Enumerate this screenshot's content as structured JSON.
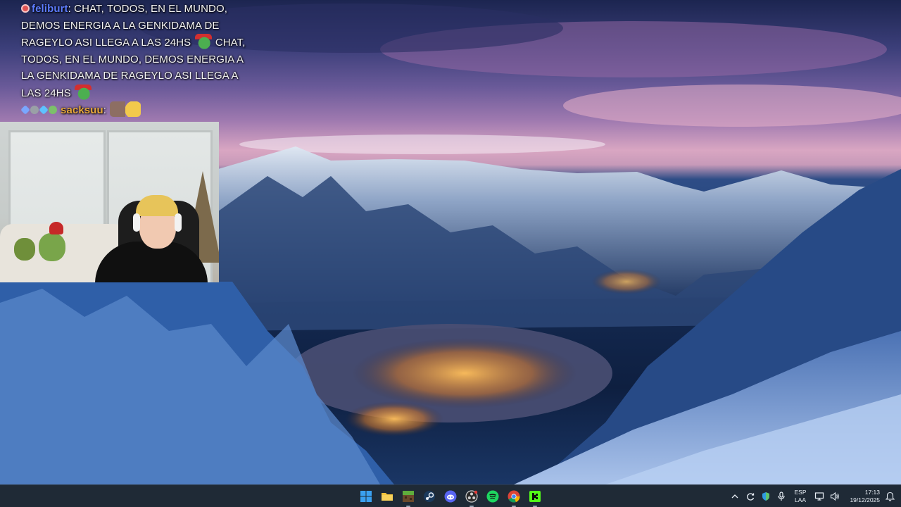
{
  "chat": {
    "messages": [
      {
        "user": "feliburt",
        "text_1": ": CHAT, TODOS, EN EL MUNDO, DEMOS ENERGIA A LA GENKIDAMA DE RAGEYLO ASI LLEGA A LAS 24HS ",
        "text_2": " CHAT, TODOS, EN EL MUNDO, DEMOS ENERGIA A LA GENKIDAMA DE RAGEYLO ASI LLEGA A LAS 24HS "
      },
      {
        "user": "sacksuu",
        "text": ":"
      }
    ]
  },
  "taskbar": {
    "apps": [
      {
        "name": "Start",
        "icon": "windows-icon"
      },
      {
        "name": "File Explorer",
        "icon": "folder-icon"
      },
      {
        "name": "Minecraft",
        "icon": "minecraft-icon"
      },
      {
        "name": "Steam",
        "icon": "steam-icon"
      },
      {
        "name": "Discord",
        "icon": "discord-icon"
      },
      {
        "name": "OBS Studio",
        "icon": "obs-icon"
      },
      {
        "name": "Spotify",
        "icon": "spotify-icon"
      },
      {
        "name": "Chrome",
        "icon": "chrome-icon"
      },
      {
        "name": "Kick",
        "icon": "kick-icon"
      }
    ],
    "tray": {
      "language_line1": "ESP",
      "language_line2": "LAA",
      "time": "17:13",
      "date": "19/12/2025"
    }
  },
  "colors": {
    "taskbar_bg": "#1f2a36",
    "feliburt_name": "#5d7cff",
    "sacksuu_name": "#e9a83a"
  }
}
